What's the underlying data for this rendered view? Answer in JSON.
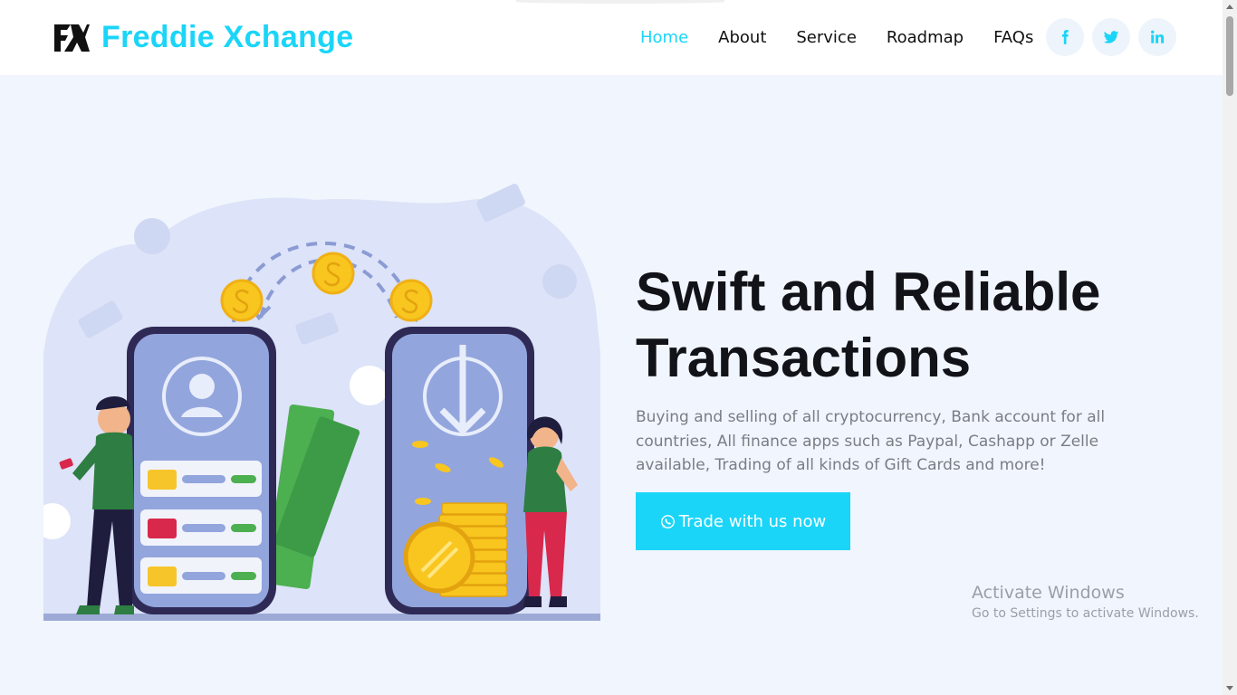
{
  "brand": {
    "name": "Freddie Xchange",
    "color": "#1ad5f8",
    "logo_icon": "fx-logo-icon"
  },
  "nav": {
    "items": [
      {
        "label": "Home",
        "active": true
      },
      {
        "label": "About",
        "active": false
      },
      {
        "label": "Service",
        "active": false
      },
      {
        "label": "Roadmap",
        "active": false
      },
      {
        "label": "FAQs",
        "active": false
      }
    ]
  },
  "socials": [
    {
      "icon": "facebook-icon"
    },
    {
      "icon": "twitter-icon"
    },
    {
      "icon": "linkedin-icon"
    }
  ],
  "hero": {
    "title_line1": "Swift and Reliable",
    "title_line2": "Transactions",
    "description": "Buying and selling of all cryptocurrency, Bank account for all countries, All finance apps such as Paypal, Cashapp or Zelle available, Trading of all kinds of Gift Cards and more!",
    "cta_label": "Trade with us now",
    "cta_icon": "whatsapp-icon",
    "illustration": "money-transfer-illustration"
  },
  "watermark": {
    "title": "Activate Windows",
    "subtitle": "Go to Settings to activate Windows."
  },
  "colors": {
    "hero_bg": "#f1f5fd",
    "title": "#111318",
    "body_text": "#7a7d84",
    "cta_bg": "#1ad5f8"
  }
}
